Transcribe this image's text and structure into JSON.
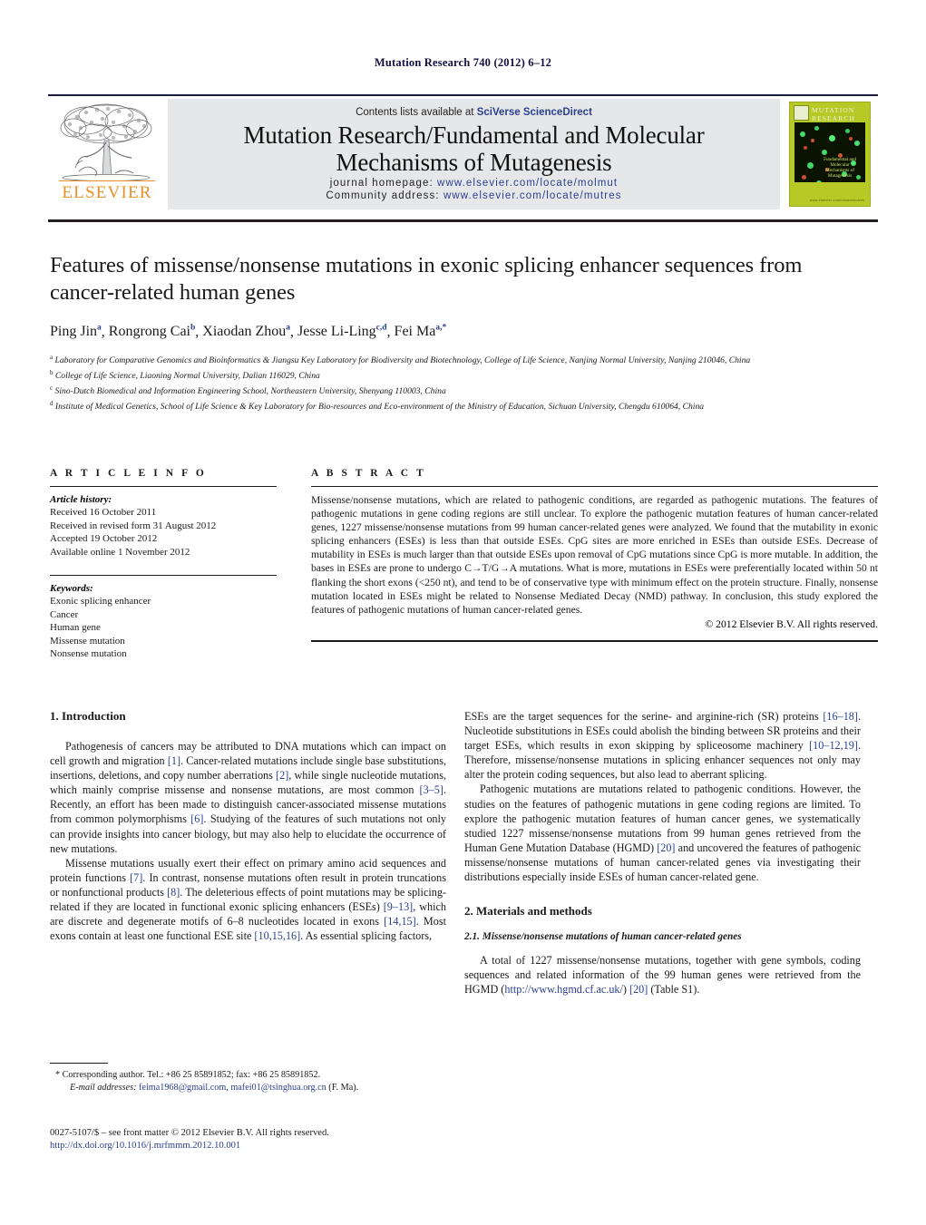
{
  "running_head": "Mutation Research 740 (2012) 6–12",
  "masthead": {
    "contents_prefix": "Contents lists available at ",
    "sciencedirect": "SciVerse ScienceDirect",
    "journal_title_line1": "Mutation Research/Fundamental and Molecular",
    "journal_title_line2": "Mechanisms of Mutagenesis",
    "homepage_label": "journal homepage:",
    "homepage_url": "www.elsevier.com/locate/molmut",
    "community_label": "Community address:",
    "community_url": "www.elsevier.com/locate/mutres",
    "publisher_wordmark": "ELSEVIER",
    "cover": {
      "title_line1": "MUTATION",
      "title_line2": "RESEARCH",
      "subtitle_line1": "Fundamental and Molecular",
      "subtitle_line2": "Mechanisms of Mutagenesis",
      "footer": "www.elsevier.com/locate/mutres"
    }
  },
  "article": {
    "title": "Features of missense/nonsense mutations in exonic splicing enhancer sequences from cancer-related human genes",
    "authors": [
      {
        "name": "Ping Jin",
        "marks": "a"
      },
      {
        "name": "Rongrong Cai",
        "marks": "b"
      },
      {
        "name": "Xiaodan Zhou",
        "marks": "a"
      },
      {
        "name": "Jesse Li-Ling",
        "marks": "c,d"
      },
      {
        "name": "Fei Ma",
        "marks": "a,*"
      }
    ],
    "affiliations": [
      {
        "mark": "a",
        "text": "Laboratory for Comparative Genomics and Bioinformatics & Jiangsu Key Laboratory for Biodiversity and Biotechnology, College of Life Science, Nanjing Normal University, Nanjing 210046, China"
      },
      {
        "mark": "b",
        "text": "College of Life Science, Liaoning Normal University, Dalian 116029, China"
      },
      {
        "mark": "c",
        "text": "Sino-Dutch Biomedical and Information Engineering School, Northeastern University, Shenyang 110003, China"
      },
      {
        "mark": "d",
        "text": "Institute of Medical Genetics, School of Life Science & Key Laboratory for Bio-resources and Eco-environment of the Ministry of Education, Sichuan University, Chengdu 610064, China"
      }
    ]
  },
  "article_info": {
    "heading": "A R T I C L E   I N F O",
    "history_heading": "Article history:",
    "history": [
      "Received 16 October 2011",
      "Received in revised form 31 August 2012",
      "Accepted 19 October 2012",
      "Available online 1 November 2012"
    ],
    "keywords_heading": "Keywords:",
    "keywords": [
      "Exonic splicing enhancer",
      "Cancer",
      "Human gene",
      "Missense mutation",
      "Nonsense mutation"
    ]
  },
  "abstract": {
    "heading": "A B S T R A C T",
    "text": "Missense/nonsense mutations, which are related to pathogenic conditions, are regarded as pathogenic mutations. The features of pathogenic mutations in gene coding regions are still unclear. To explore the pathogenic mutation features of human cancer-related genes, 1227 missense/nonsense mutations from 99 human cancer-related genes were analyzed. We found that the mutability in exonic splicing enhancers (ESEs) is less than that outside ESEs. CpG sites are more enriched in ESEs than outside ESEs. Decrease of mutability in ESEs is much larger than that outside ESEs upon removal of CpG mutations since CpG is more mutable. In addition, the bases in ESEs are prone to undergo C→T/G→A mutations. What is more, mutations in ESEs were preferentially located within 50 nt flanking the short exons (<250 nt), and tend to be of conservative type with minimum effect on the protein structure. Finally, nonsense mutation located in ESEs might be related to Nonsense Mediated Decay (NMD) pathway. In conclusion, this study explored the features of pathogenic mutations of human cancer-related genes.",
    "copyright": "© 2012 Elsevier B.V. All rights reserved."
  },
  "sections": {
    "introduction_heading": "1.  Introduction",
    "intro_p1_a": "Pathogenesis of cancers may be attributed to DNA mutations which can impact on cell growth and migration ",
    "intro_p1_r1": "[1]",
    "intro_p1_b": ". Cancer-related mutations include single base substitutions, insertions, deletions, and copy number aberrations ",
    "intro_p1_r2": "[2]",
    "intro_p1_c": ", while single nucleotide mutations, which mainly comprise missense and nonsense mutations, are most common ",
    "intro_p1_r3": "[3–5]",
    "intro_p1_d": ". Recently, an effort has been made to distinguish cancer-associated missense mutations from common polymorphisms ",
    "intro_p1_r4": "[6]",
    "intro_p1_e": ". Studying of the features of such mutations not only can provide insights into cancer biology, but may also help to elucidate the occurrence of new mutations.",
    "intro_p2_a": "Missense mutations usually exert their effect on primary amino acid sequences and protein functions ",
    "intro_p2_r1": "[7]",
    "intro_p2_b": ". In contrast, nonsense mutations often result in protein truncations or nonfunctional products ",
    "intro_p2_r2": "[8]",
    "intro_p2_c": ". The deleterious effects of point mutations may be splicing-related if they are located in functional exonic splicing enhancers (ESEs) ",
    "intro_p2_r3": "[9–13]",
    "intro_p2_d": ", which are discrete and degenerate motifs of 6–8 nucleotides located in exons ",
    "intro_p2_r4": "[14,15]",
    "intro_p2_e": ". Most exons contain at least one functional ESE site ",
    "intro_p2_r5": "[10,15,16]",
    "intro_p2_f": ". As essential splicing factors,",
    "intro_p3_a": "ESEs are the target sequences for the serine- and arginine-rich (SR) proteins ",
    "intro_p3_r1": "[16–18]",
    "intro_p3_b": ". Nucleotide substitutions in ESEs could abolish the binding between SR proteins and their target ESEs, which results in exon skipping by spliceosome machinery ",
    "intro_p3_r2": "[10–12,19]",
    "intro_p3_c": ". Therefore, missense/nonsense mutations in splicing enhancer sequences not only may alter the protein coding sequences, but also lead to aberrant splicing.",
    "intro_p4_a": "Pathogenic mutations are mutations related to pathogenic conditions. However, the studies on the features of pathogenic mutations in gene coding regions are limited. To explore the pathogenic mutation features of human cancer genes, we systematically studied 1227 missense/nonsense mutations from 99 human genes retrieved from the Human Gene Mutation Database (HGMD) ",
    "intro_p4_r1": "[20]",
    "intro_p4_b": " and uncovered the features of pathogenic missense/nonsense mutations of human cancer-related genes via investigating their distributions especially inside ESEs of human cancer-related gene.",
    "methods_heading": "2.  Materials and methods",
    "methods_sub_heading": "2.1.  Missense/nonsense mutations of human cancer-related genes",
    "methods_p1_a": "A total of 1227 missense/nonsense mutations, together with gene symbols, coding sequences and related information of the 99 human genes were retrieved from the HGMD (",
    "methods_p1_url": "http://www.hgmd.cf.ac.uk/",
    "methods_p1_b": ") ",
    "methods_p1_r1": "[20]",
    "methods_p1_c": " (Table S1)."
  },
  "footnotes": {
    "corresponding_marker": "*",
    "corresponding": " Corresponding author. Tel.: +86 25 85891852; fax: +86 25 85891852.",
    "email_label": "E-mail addresses:",
    "email1": "feima1968@gmail.com",
    "email_sep": ", ",
    "email2": "mafei01@tsinghua.org.cn",
    "email_suffix": " (F. Ma).",
    "issn_line": "0027-5107/$ – see front matter © 2012 Elsevier B.V. All rights reserved.",
    "doi_line": "http://dx.doi.org/10.1016/j.mrfmmm.2012.10.001"
  },
  "colors": {
    "link": "#2a3f8f",
    "elsevier_orange": "#E8912B",
    "masthead_gray": "#e6e7e8",
    "cover_green": "#b6c926"
  }
}
